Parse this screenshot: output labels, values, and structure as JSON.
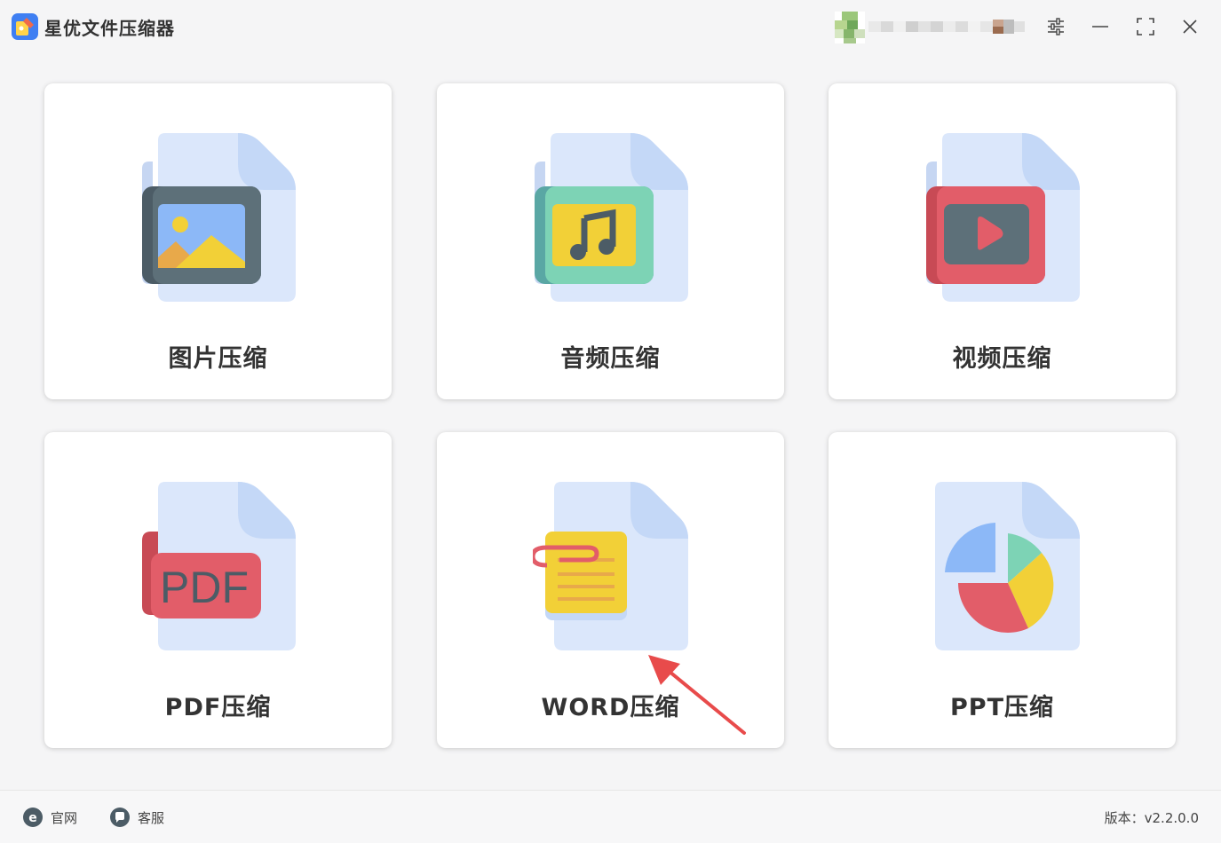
{
  "app": {
    "title": "星优文件压缩器"
  },
  "cards": [
    {
      "id": "image",
      "label": "图片压缩",
      "icon": "image-file-icon"
    },
    {
      "id": "audio",
      "label": "音频压缩",
      "icon": "music-file-icon"
    },
    {
      "id": "video",
      "label": "视频压缩",
      "icon": "video-file-icon"
    },
    {
      "id": "pdf",
      "label": "PDF压缩",
      "icon": "pdf-file-icon",
      "icon_text": "PDF"
    },
    {
      "id": "word",
      "label": "WORD压缩",
      "icon": "word-file-icon"
    },
    {
      "id": "ppt",
      "label": "PPT压缩",
      "icon": "ppt-file-icon"
    }
  ],
  "footer": {
    "site_label": "官网",
    "service_label": "客服",
    "version_text": "版本：v2.2.0.0"
  },
  "colors": {
    "page_bg": "#f5f5f6",
    "file_back": "#dbe7fb",
    "annotation_arrow": "#e84b4b"
  }
}
